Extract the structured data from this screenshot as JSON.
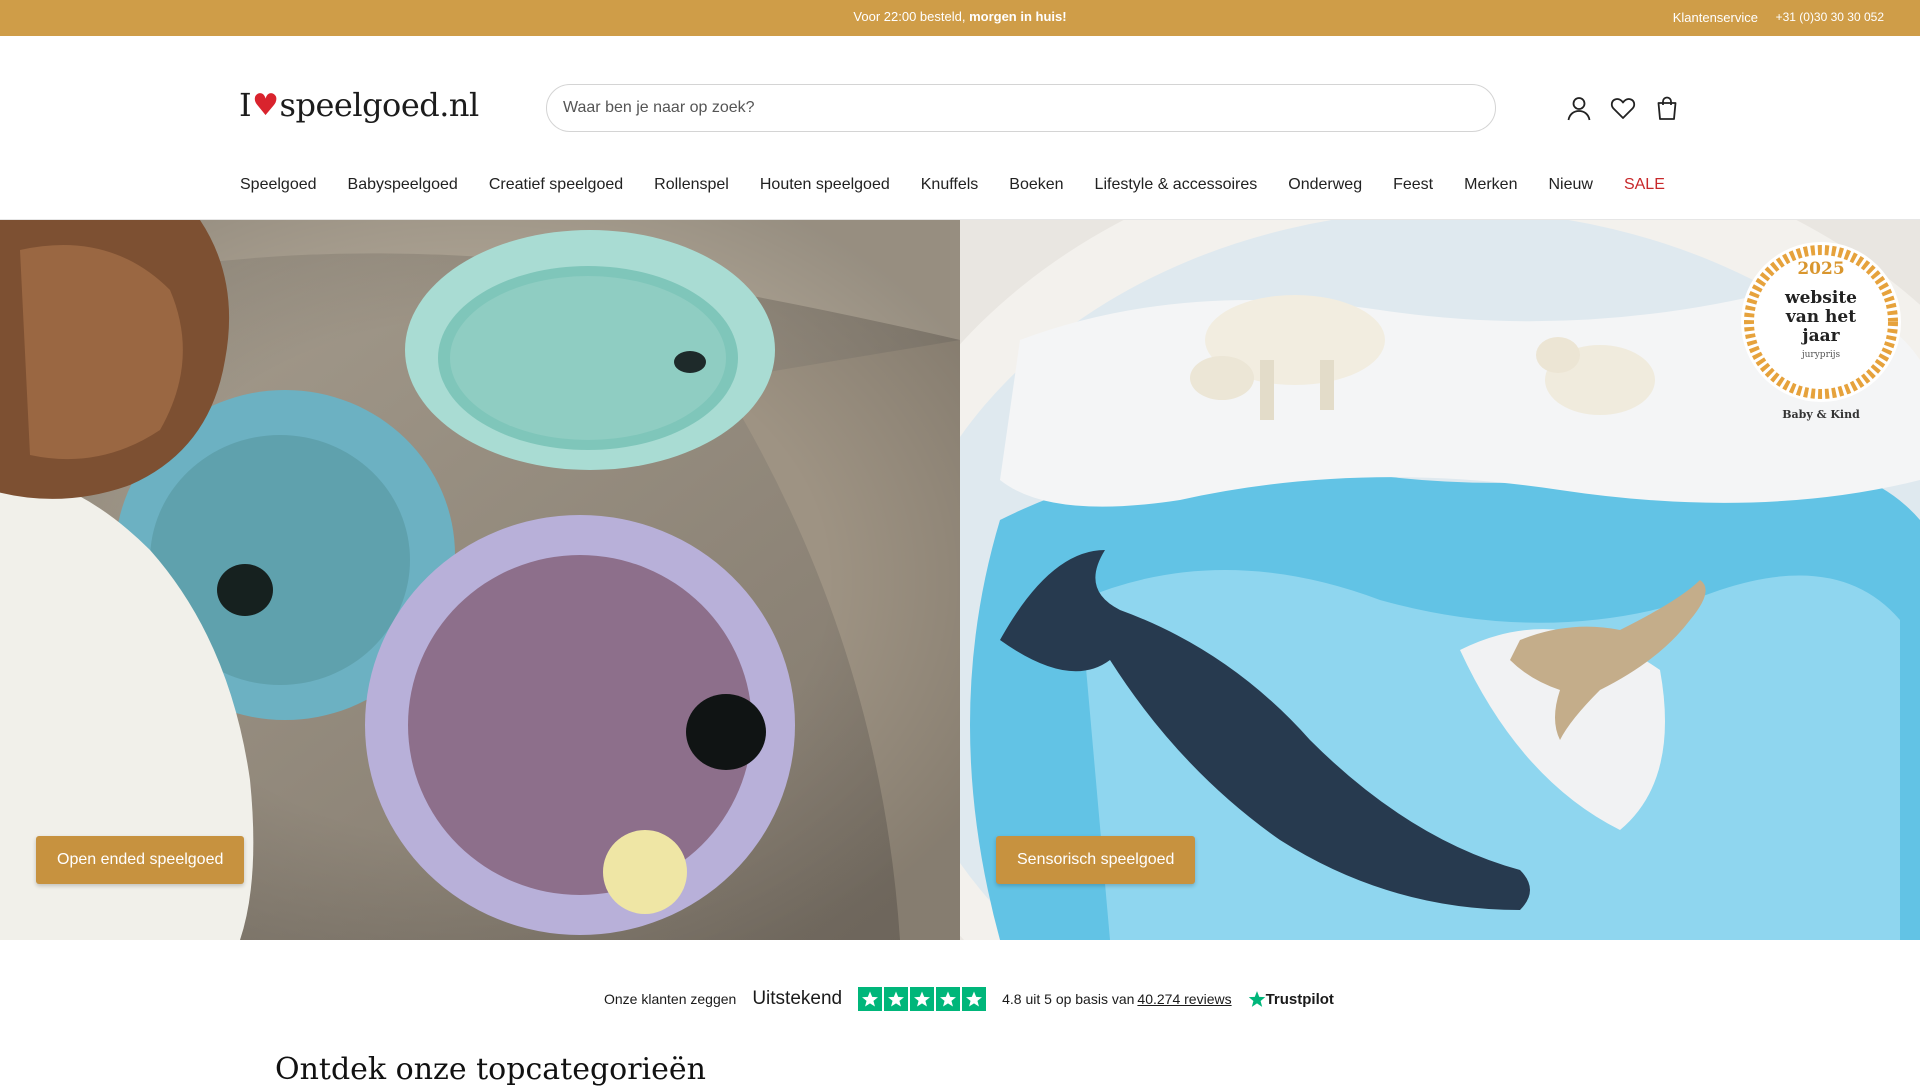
{
  "topbar": {
    "promo_prefix": "Voor 22:00 besteld, ",
    "promo_bold": "morgen in huis!",
    "service": "Klantenservice",
    "phone": "+31 (0)30 30 30 052"
  },
  "logo": {
    "prefix": "I",
    "heart": "♥",
    "name": "speelgoed.nl"
  },
  "search": {
    "placeholder": "Waar ben je naar op zoek?"
  },
  "header_icons": [
    "account-icon",
    "wishlist-heart-icon",
    "shopping-bag-icon"
  ],
  "nav": [
    {
      "label": "Speelgoed"
    },
    {
      "label": "Babyspeelgoed"
    },
    {
      "label": "Creatief speelgoed"
    },
    {
      "label": "Rollenspel"
    },
    {
      "label": "Houten speelgoed"
    },
    {
      "label": "Knuffels"
    },
    {
      "label": "Boeken"
    },
    {
      "label": "Lifestyle & accessoires"
    },
    {
      "label": "Onderweg"
    },
    {
      "label": "Feest"
    },
    {
      "label": "Merken"
    },
    {
      "label": "Nieuw"
    },
    {
      "label": "SALE"
    }
  ],
  "hero": {
    "left_button": "Open ended speelgoed",
    "right_button": "Sensorisch speelgoed",
    "award": {
      "year": "2025",
      "line1": "website",
      "line2": "van het",
      "line3": "jaar",
      "sub": "juryprijs",
      "brand": "Baby & Kind"
    }
  },
  "trustpilot": {
    "say": "Onze klanten zeggen",
    "rating_word": "Uitstekend",
    "score_text": "4.8 uit 5 op basis van",
    "reviews_text": "40.274 reviews",
    "brand": "Trustpilot",
    "stars": 5,
    "star_color": "#00b67a"
  },
  "section": {
    "title": "Ontdek onze topcategorieën"
  },
  "colors": {
    "accent": "#cf9d48",
    "button": "#c7923f",
    "sale": "#c8282a"
  }
}
